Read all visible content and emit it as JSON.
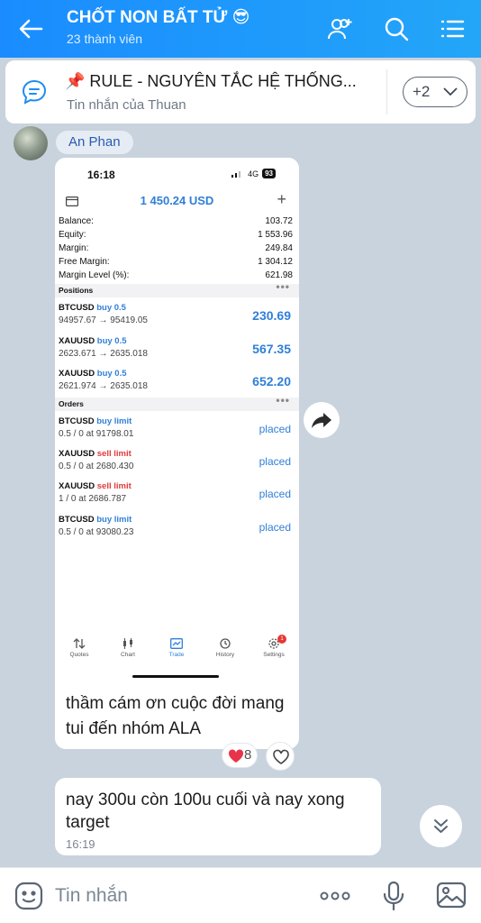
{
  "header": {
    "title": "CHỐT NON BẤT TỬ 😎",
    "subtitle": "23 thành viên",
    "icons": [
      "back-arrow-icon",
      "add-member-icon",
      "search-icon",
      "menu-list-icon"
    ]
  },
  "pinned": {
    "title": "📌 RULE - NGUYÊN TẮC HỆ THỐNG...",
    "subtitle": "Tin nhắn của Thuan",
    "more_label": "+2"
  },
  "sender": {
    "name": "An Phan"
  },
  "screenshot": {
    "status_time": "16:18",
    "status_net": "4G",
    "status_battery": "93",
    "account_amount": "1 450.24 USD",
    "summary": [
      {
        "label": "Balance:",
        "value": "103.72"
      },
      {
        "label": "Equity:",
        "value": "1 553.96"
      },
      {
        "label": "Margin:",
        "value": "249.84"
      },
      {
        "label": "Free Margin:",
        "value": "1 304.12"
      },
      {
        "label": "Margin Level (%):",
        "value": "621.98"
      }
    ],
    "positions_label": "Positions",
    "positions": [
      {
        "symbol": "BTCUSD",
        "side": "buy 0.5",
        "prices": "94957.67 → 95419.05",
        "profit": "230.69"
      },
      {
        "symbol": "XAUUSD",
        "side": "buy 0.5",
        "prices": "2623.671 → 2635.018",
        "profit": "567.35"
      },
      {
        "symbol": "XAUUSD",
        "side": "buy 0.5",
        "prices": "2621.974 → 2635.018",
        "profit": "652.20"
      }
    ],
    "orders_label": "Orders",
    "orders": [
      {
        "symbol": "BTCUSD",
        "side": "buy limit",
        "detail": "0.5 / 0 at 91798.01",
        "status": "placed"
      },
      {
        "symbol": "XAUUSD",
        "side": "sell limit",
        "detail": "0.5 / 0 at 2680.430",
        "status": "placed"
      },
      {
        "symbol": "XAUUSD",
        "side": "sell limit",
        "detail": "1 / 0 at 2686.787",
        "status": "placed"
      },
      {
        "symbol": "BTCUSD",
        "side": "buy limit",
        "detail": "0.5 / 0 at 93080.23",
        "status": "placed"
      }
    ],
    "tabs": [
      "Quotes",
      "Chart",
      "Trade",
      "History",
      "Settings"
    ],
    "settings_badge": "1"
  },
  "message1": {
    "caption": "thầm cám ơn cuộc đời mang tui đến nhóm ALA",
    "reaction_count": "8"
  },
  "message2": {
    "text": "nay 300u còn 100u cuối và nay xong target",
    "time": "16:19"
  },
  "input": {
    "placeholder": "Tin nhắn"
  },
  "colors": {
    "header": "#1f9bfb",
    "background": "#c9d3dd",
    "link": "#2f7fd8",
    "sell": "#e03a3a"
  }
}
